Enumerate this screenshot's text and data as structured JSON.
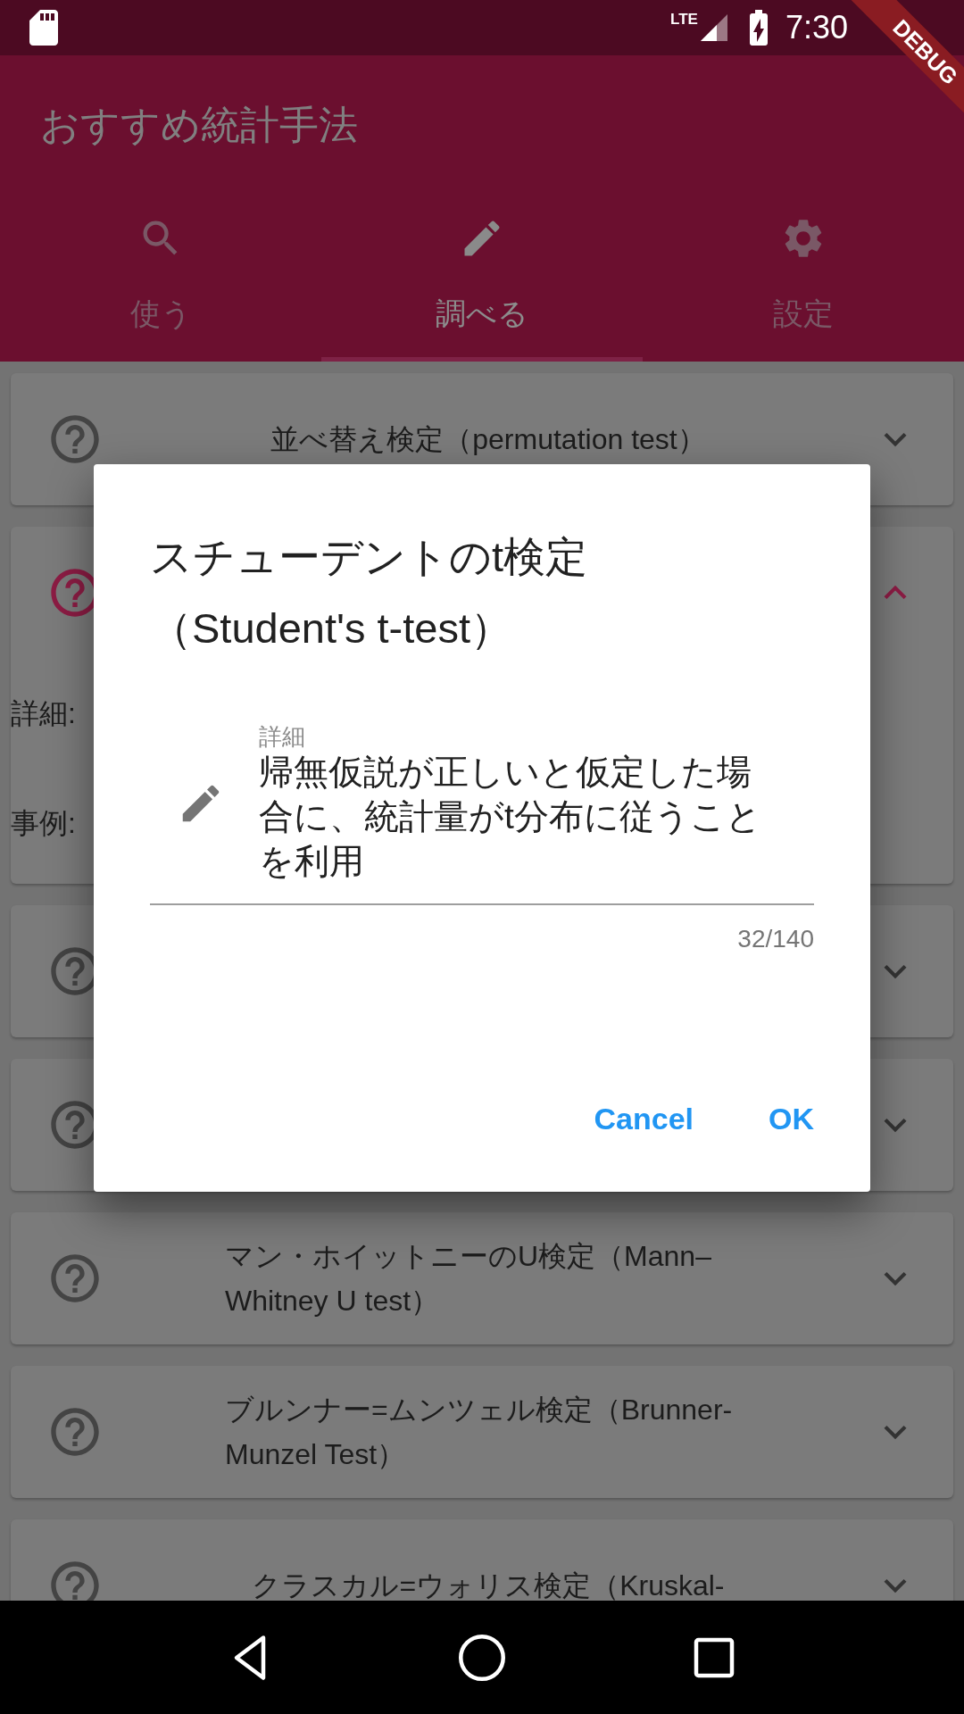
{
  "status_bar": {
    "network": "LTE",
    "time": "7:30"
  },
  "debug_banner": "DEBUG",
  "app_bar": {
    "title": "おすすめ統計手法"
  },
  "tabs": [
    {
      "label": "使う",
      "kind": "search",
      "selected": false
    },
    {
      "label": "調べる",
      "kind": "pencil",
      "selected": true
    },
    {
      "label": "設定",
      "kind": "gear",
      "selected": false
    }
  ],
  "methods": [
    {
      "title": "並べ替え検定（permutation test）",
      "expanded": false
    },
    {
      "expanded": true,
      "fields": [
        "詳細:",
        "事例:"
      ]
    },
    {
      "expanded": false
    },
    {
      "expanded": false
    },
    {
      "title": "マン・ホイットニーのU検定（Mann–Whitney U test）",
      "expanded": false
    },
    {
      "title": "ブルンナー=ムンツェル検定（Brunner-Munzel Test）",
      "expanded": false
    },
    {
      "title": "クラスカル=ウォリス検定（Kruskal-",
      "expanded": false
    }
  ],
  "dialog": {
    "title": "スチューデントのt検定（Student's t-test）",
    "field": {
      "label": "詳細",
      "value": "帰無仮説が正しいと仮定した場合に、統計量がt分布に従うことを利用",
      "counter": "32/140"
    },
    "buttons": [
      "Cancel",
      "OK"
    ]
  }
}
